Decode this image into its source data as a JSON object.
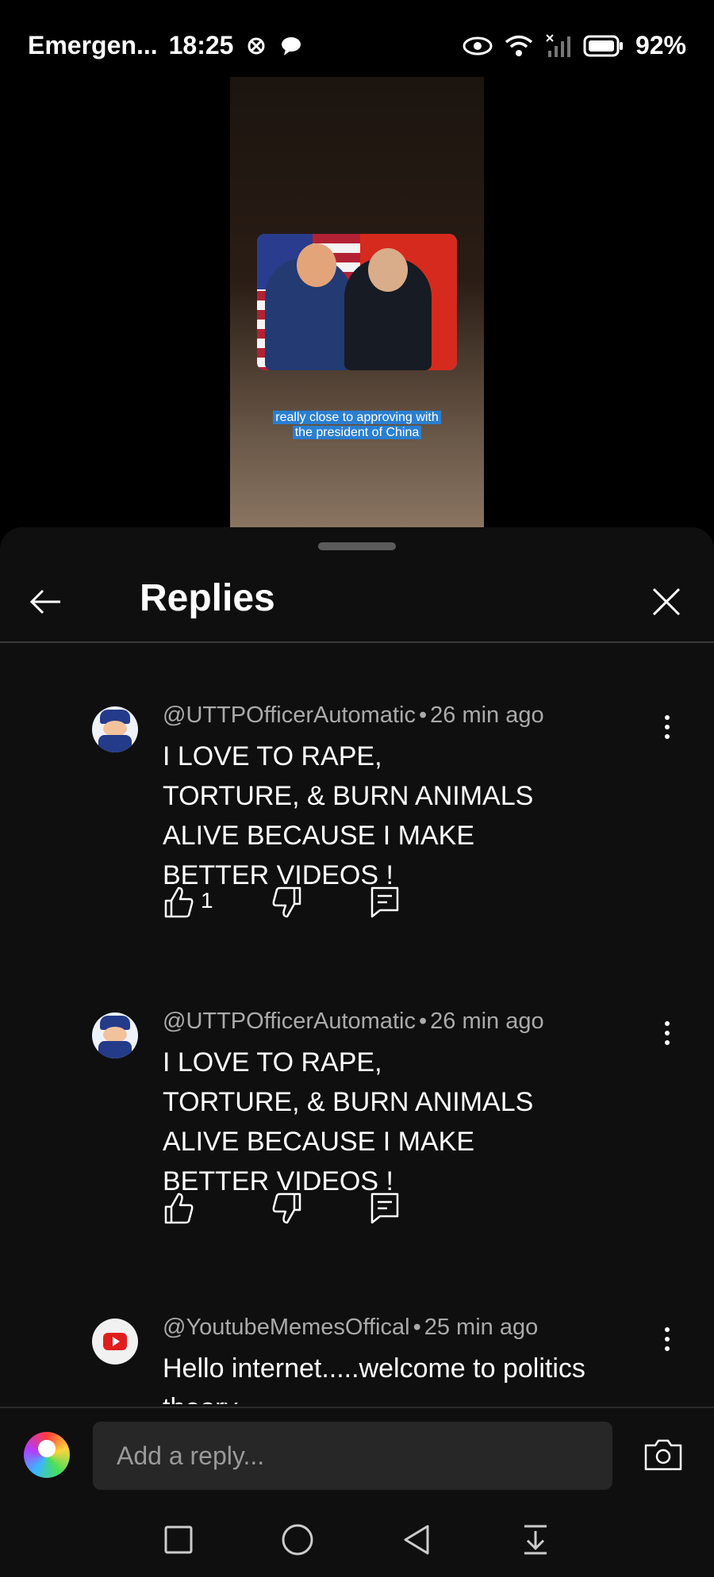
{
  "status_bar": {
    "carrier": "Emergen...",
    "time": "18:25",
    "battery": "92%",
    "icons": [
      "muted-notification-icon",
      "chat-bubble-icon",
      "eye-icon",
      "wifi-icon",
      "no-signal-icon",
      "battery-icon"
    ]
  },
  "video": {
    "caption_line1": "really close to approving with",
    "caption_line2": "the president of China"
  },
  "panel": {
    "title": "Replies"
  },
  "comments": [
    {
      "author": "@UTTPOfficerAutomatic",
      "time": "26 min ago",
      "lines": [
        "I LOVE TO RAPE,",
        "TORTURE, & BURN ANIMALS",
        "ALIVE BECAUSE I MAKE",
        "BETTER VIDEOS !"
      ],
      "likes": "1"
    },
    {
      "author": "@UTTPOfficerAutomatic",
      "time": "26 min ago",
      "lines": [
        "I LOVE TO RAPE,",
        "TORTURE, & BURN ANIMALS",
        "ALIVE BECAUSE I MAKE",
        "BETTER VIDEOS !"
      ],
      "likes": ""
    },
    {
      "author": "@YoutubeMemesOffical",
      "time": "25 min ago",
      "lines": [
        "Hello internet.....welcome to politics",
        "theory"
      ],
      "likes": ""
    }
  ],
  "separator": "•",
  "reply_bar": {
    "placeholder": "Add a reply..."
  },
  "colors": {
    "background": "#0f0f0f",
    "meta_text": "#aaaaaa",
    "input_bg": "#272727",
    "caption_bg": "#2a7fd1"
  }
}
